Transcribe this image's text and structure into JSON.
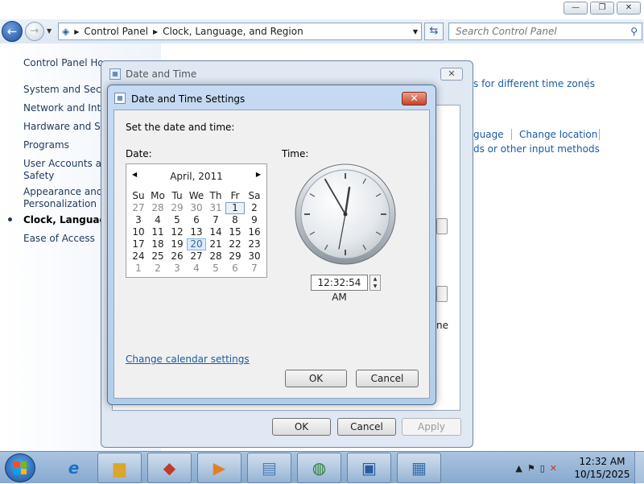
{
  "window_controls": {
    "minimize": "—",
    "maximize": "❐",
    "close": "✕"
  },
  "address_bar": {
    "crumbs": [
      "Control Panel",
      "Clock, Language, and Region"
    ],
    "search_placeholder": "Search Control Panel"
  },
  "sidebar": {
    "items": [
      {
        "label": "Control Panel Hom"
      },
      {
        "label": "System and Securi"
      },
      {
        "label": "Network and Inter"
      },
      {
        "label": "Hardware and Sou"
      },
      {
        "label": "Programs"
      },
      {
        "label": "User Accounts and"
      },
      {
        "label": "Safety"
      },
      {
        "label": "Appearance and"
      },
      {
        "label": "Personalization"
      },
      {
        "label": "Clock, Language, a"
      },
      {
        "label": "Ease of Access"
      }
    ]
  },
  "right_links": {
    "time_zones": "s for different time zones",
    "language": "guage",
    "change_location": "Change location",
    "input_methods": "ds or other input methods",
    "partial": "ne"
  },
  "outer_dialog": {
    "title": "Date and Time",
    "ok": "OK",
    "cancel": "Cancel",
    "apply": "Apply"
  },
  "inner_dialog": {
    "title": "Date and Time Settings",
    "instruction": "Set the date and time:",
    "date_label": "Date:",
    "time_label": "Time:",
    "month": "April, 2011",
    "weekdays": [
      "Su",
      "Mo",
      "Tu",
      "We",
      "Th",
      "Fr",
      "Sa"
    ],
    "weeks": [
      [
        "27",
        "28",
        "29",
        "30",
        "31",
        "1",
        "2"
      ],
      [
        "3",
        "4",
        "5",
        "6",
        "7",
        "8",
        "9"
      ],
      [
        "10",
        "11",
        "12",
        "13",
        "14",
        "15",
        "16"
      ],
      [
        "17",
        "18",
        "19",
        "20",
        "21",
        "22",
        "23"
      ],
      [
        "24",
        "25",
        "26",
        "27",
        "28",
        "29",
        "30"
      ],
      [
        "1",
        "2",
        "3",
        "4",
        "5",
        "6",
        "7"
      ]
    ],
    "time_value": "12:32:54 AM",
    "change_calendar": "Change calendar settings",
    "ok": "OK",
    "cancel": "Cancel"
  },
  "taskbar": {
    "clock_time": "12:32 AM",
    "clock_date": "10/15/2025"
  }
}
